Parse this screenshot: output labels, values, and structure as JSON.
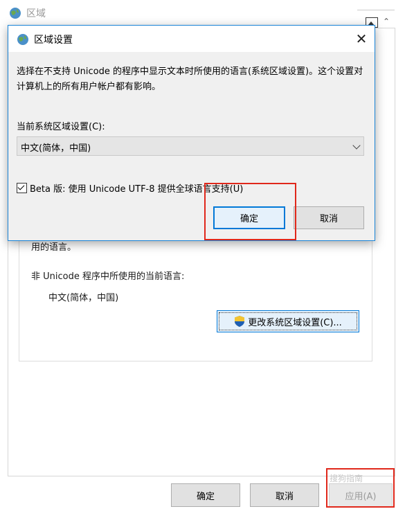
{
  "background_window": {
    "title": "区域",
    "partial_text": "用的语言。",
    "current_lang_label": "非 Unicode 程序中所使用的当前语言:",
    "current_lang_value": "中文(简体，中国)",
    "change_button": "更改系统区域设置(C)...",
    "footer": {
      "ok": "确定",
      "cancel": "取消",
      "apply": "应用(A)"
    }
  },
  "dialog": {
    "title": "区域设置",
    "description": "选择在不支持 Unicode 的程序中显示文本时所使用的语言(系统区域设置)。这个设置对计算机上的所有用户帐户都有影响。",
    "locale_label": "当前系统区域设置(C):",
    "locale_value": "中文(简体，中国)",
    "beta_checkbox_label": "Beta 版: 使用 Unicode UTF-8 提供全球语言支持(U)",
    "beta_checked": true,
    "ok_button": "确定",
    "cancel_button": "取消"
  },
  "watermark": "搜狗指南",
  "colors": {
    "accent": "#0078d7",
    "highlight": "#e0271a"
  }
}
